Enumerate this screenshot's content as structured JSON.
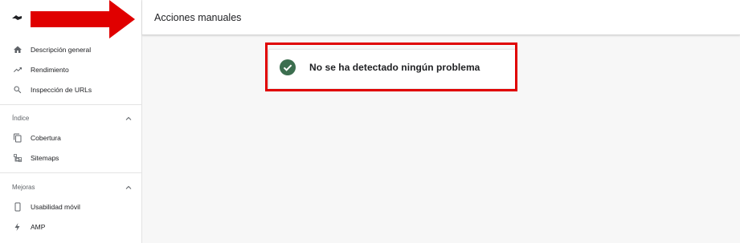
{
  "topbar": {
    "title": "Acciones manuales"
  },
  "sidebar": {
    "top_items": [
      {
        "label": "Descripción general",
        "icon": "home-icon"
      },
      {
        "label": "Rendimiento",
        "icon": "trending-up-icon"
      },
      {
        "label": "Inspección de URLs",
        "icon": "search-icon"
      }
    ],
    "sections": [
      {
        "title": "Índice",
        "items": [
          {
            "label": "Cobertura",
            "icon": "copy-icon"
          },
          {
            "label": "Sitemaps",
            "icon": "sitemap-icon"
          }
        ]
      },
      {
        "title": "Mejoras",
        "items": [
          {
            "label": "Usabilidad móvil",
            "icon": "smartphone-icon"
          },
          {
            "label": "AMP",
            "icon": "bolt-icon"
          }
        ]
      }
    ]
  },
  "main": {
    "status_message": "No se ha detectado ningún problema",
    "status_icon": "check-circle-icon"
  },
  "colors": {
    "annotation_red": "#e00000",
    "success_green": "#3c6e4f",
    "icon_grey": "#5f6368"
  }
}
